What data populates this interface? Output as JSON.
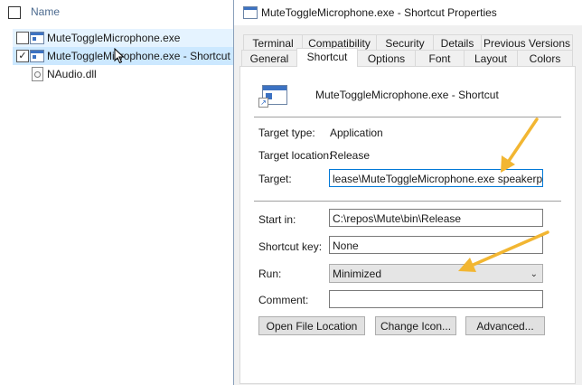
{
  "explorer": {
    "header_label": "Name",
    "items": [
      {
        "label": "MuteToggleMicrophone.exe",
        "checked": false,
        "icon": "exe-icon"
      },
      {
        "label": "MuteToggleMicrophone.exe - Shortcut",
        "checked": true,
        "icon": "shortcut-icon"
      },
      {
        "label": "NAudio.dll",
        "checked": false,
        "icon": "dll-icon"
      }
    ]
  },
  "dialog": {
    "title": "MuteToggleMicrophone.exe - Shortcut Properties",
    "tabs_row1": [
      "Terminal",
      "Compatibility",
      "Security",
      "Details",
      "Previous Versions"
    ],
    "tabs_row2": [
      "General",
      "Shortcut",
      "Options",
      "Font",
      "Layout",
      "Colors"
    ],
    "active_tab": "Shortcut",
    "shortcut_name": "MuteToggleMicrophone.exe - Shortcut",
    "target_type_label": "Target type:",
    "target_type_value": "Application",
    "target_location_label": "Target location:",
    "target_location_value": "Release",
    "target_label": "Target:",
    "target_value": "lease\\MuteToggleMicrophone.exe speakerphone",
    "start_in_label": "Start in:",
    "start_in_value": "C:\\repos\\Mute\\bin\\Release",
    "shortcut_key_label": "Shortcut key:",
    "shortcut_key_value": "None",
    "run_label": "Run:",
    "run_value": "Minimized",
    "comment_label": "Comment:",
    "comment_value": "",
    "buttons": {
      "open_file_location": "Open File Location",
      "change_icon": "Change Icon...",
      "advanced": "Advanced..."
    }
  },
  "colors": {
    "accent": "#0078d7",
    "annotation_arrow": "#f2b632",
    "selected_row": "#cce8ff"
  }
}
